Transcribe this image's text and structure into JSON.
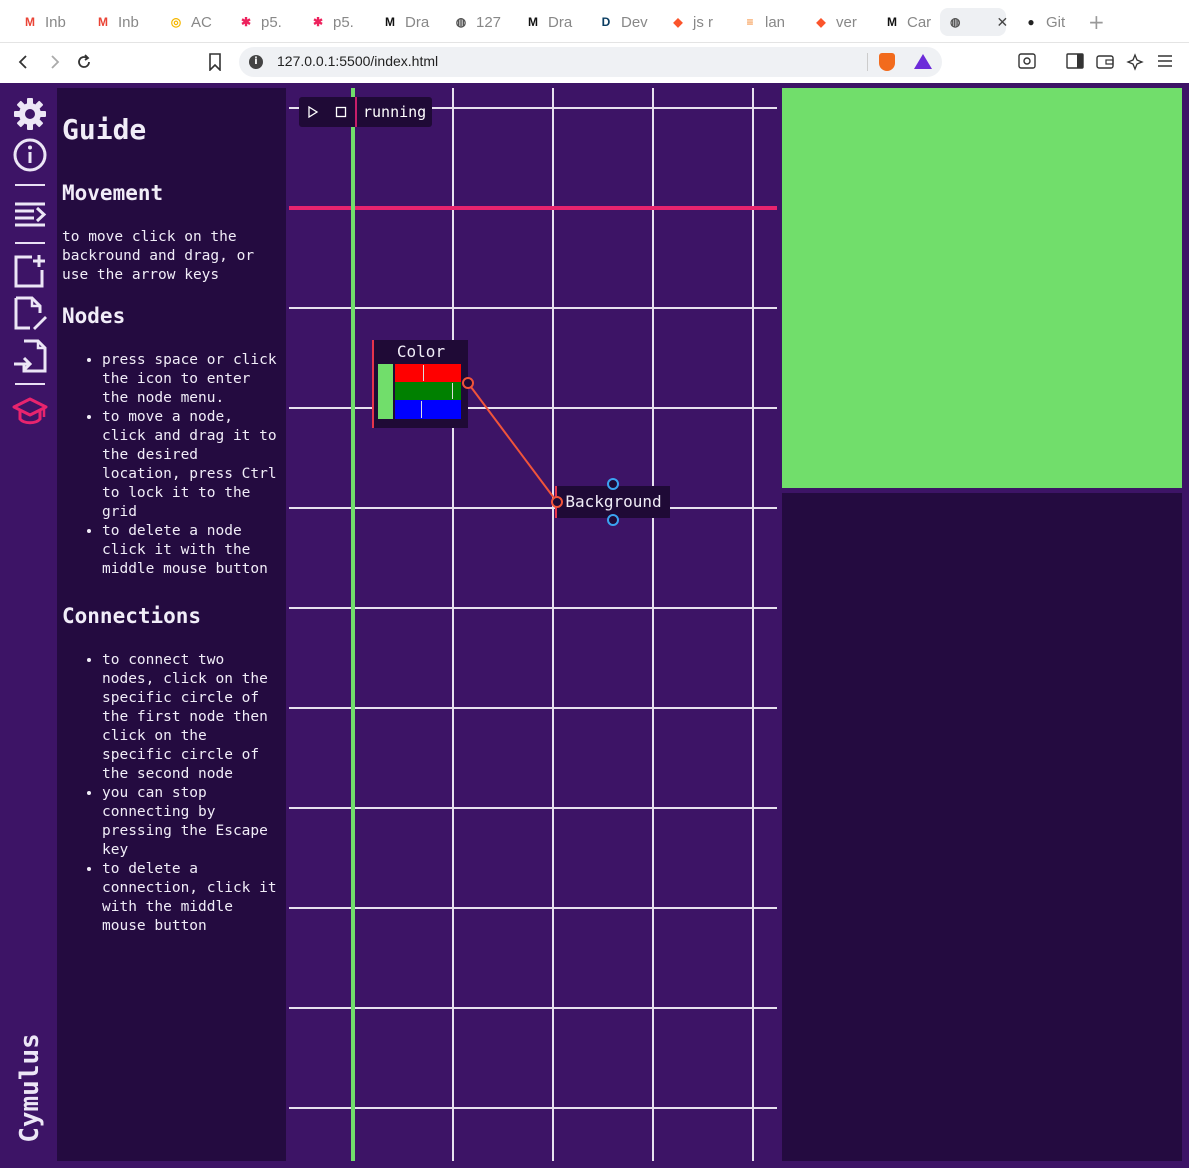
{
  "browser": {
    "tabs": [
      {
        "label": "Inb",
        "icon": "gmail-icon"
      },
      {
        "label": "Inb",
        "icon": "gmail-icon"
      },
      {
        "label": "AC",
        "icon": "ac-icon"
      },
      {
        "label": "p5.",
        "icon": "p5-icon"
      },
      {
        "label": "p5.",
        "icon": "p5-icon"
      },
      {
        "label": "Dra",
        "icon": "medium-icon"
      },
      {
        "label": "127",
        "icon": "globe-icon"
      },
      {
        "label": "Dra",
        "icon": "medium-icon"
      },
      {
        "label": "Dev",
        "icon": "dev-icon"
      },
      {
        "label": "js r",
        "icon": "brave-icon"
      },
      {
        "label": "lan",
        "icon": "stackoverflow-icon"
      },
      {
        "label": "ver",
        "icon": "brave-icon"
      },
      {
        "label": "Car",
        "icon": "medium-icon"
      },
      {
        "label": "",
        "icon": "globe-icon",
        "active": true
      },
      {
        "label": "Git",
        "icon": "github-icon"
      }
    ],
    "url": "127.0.0.1:5500/index.html"
  },
  "sidebar": {
    "icons": [
      "gear-icon",
      "info-icon",
      "list-icon",
      "new-file-icon",
      "edit-file-icon",
      "import-file-icon",
      "graduation-cap-icon"
    ],
    "brand": "Cymulus",
    "accent": "#e8246e"
  },
  "guide": {
    "title": "Guide",
    "movement": {
      "heading": "Movement",
      "text": "to move click on the backround and drag, or use the arrow keys"
    },
    "nodes": {
      "heading": "Nodes",
      "items": [
        "press space or click the icon to enter the node menu.",
        "to move a node, click and drag it to the desired location, press Ctrl to lock it to the grid",
        "to delete a node click it with the middle mouse button"
      ]
    },
    "connections": {
      "heading": "Connections",
      "items": [
        "to connect two nodes, click on the specific circle of the first node then click on the specific circle of the second node",
        "you can stop connecting by pressing the Escape key",
        "to delete a connection, click it with the middle mouse button"
      ]
    }
  },
  "editor": {
    "status": "running",
    "play_icon": "play-icon",
    "stop_icon": "stop-icon",
    "grid_color": "#e7e1ef",
    "x_axis_color": "#e8246e",
    "y_axis_color": "#71de6b",
    "nodes": {
      "color": {
        "title": "Color",
        "swatch": "#71de6b",
        "channels": [
          "#ff0000",
          "#008000",
          "#0000ff"
        ]
      },
      "background": {
        "title": "Background"
      }
    },
    "connection_color": "#f0543a",
    "port_color": "#3ba3f0"
  },
  "preview": {
    "color": "#71de6b",
    "panel_color": "#240b40"
  }
}
